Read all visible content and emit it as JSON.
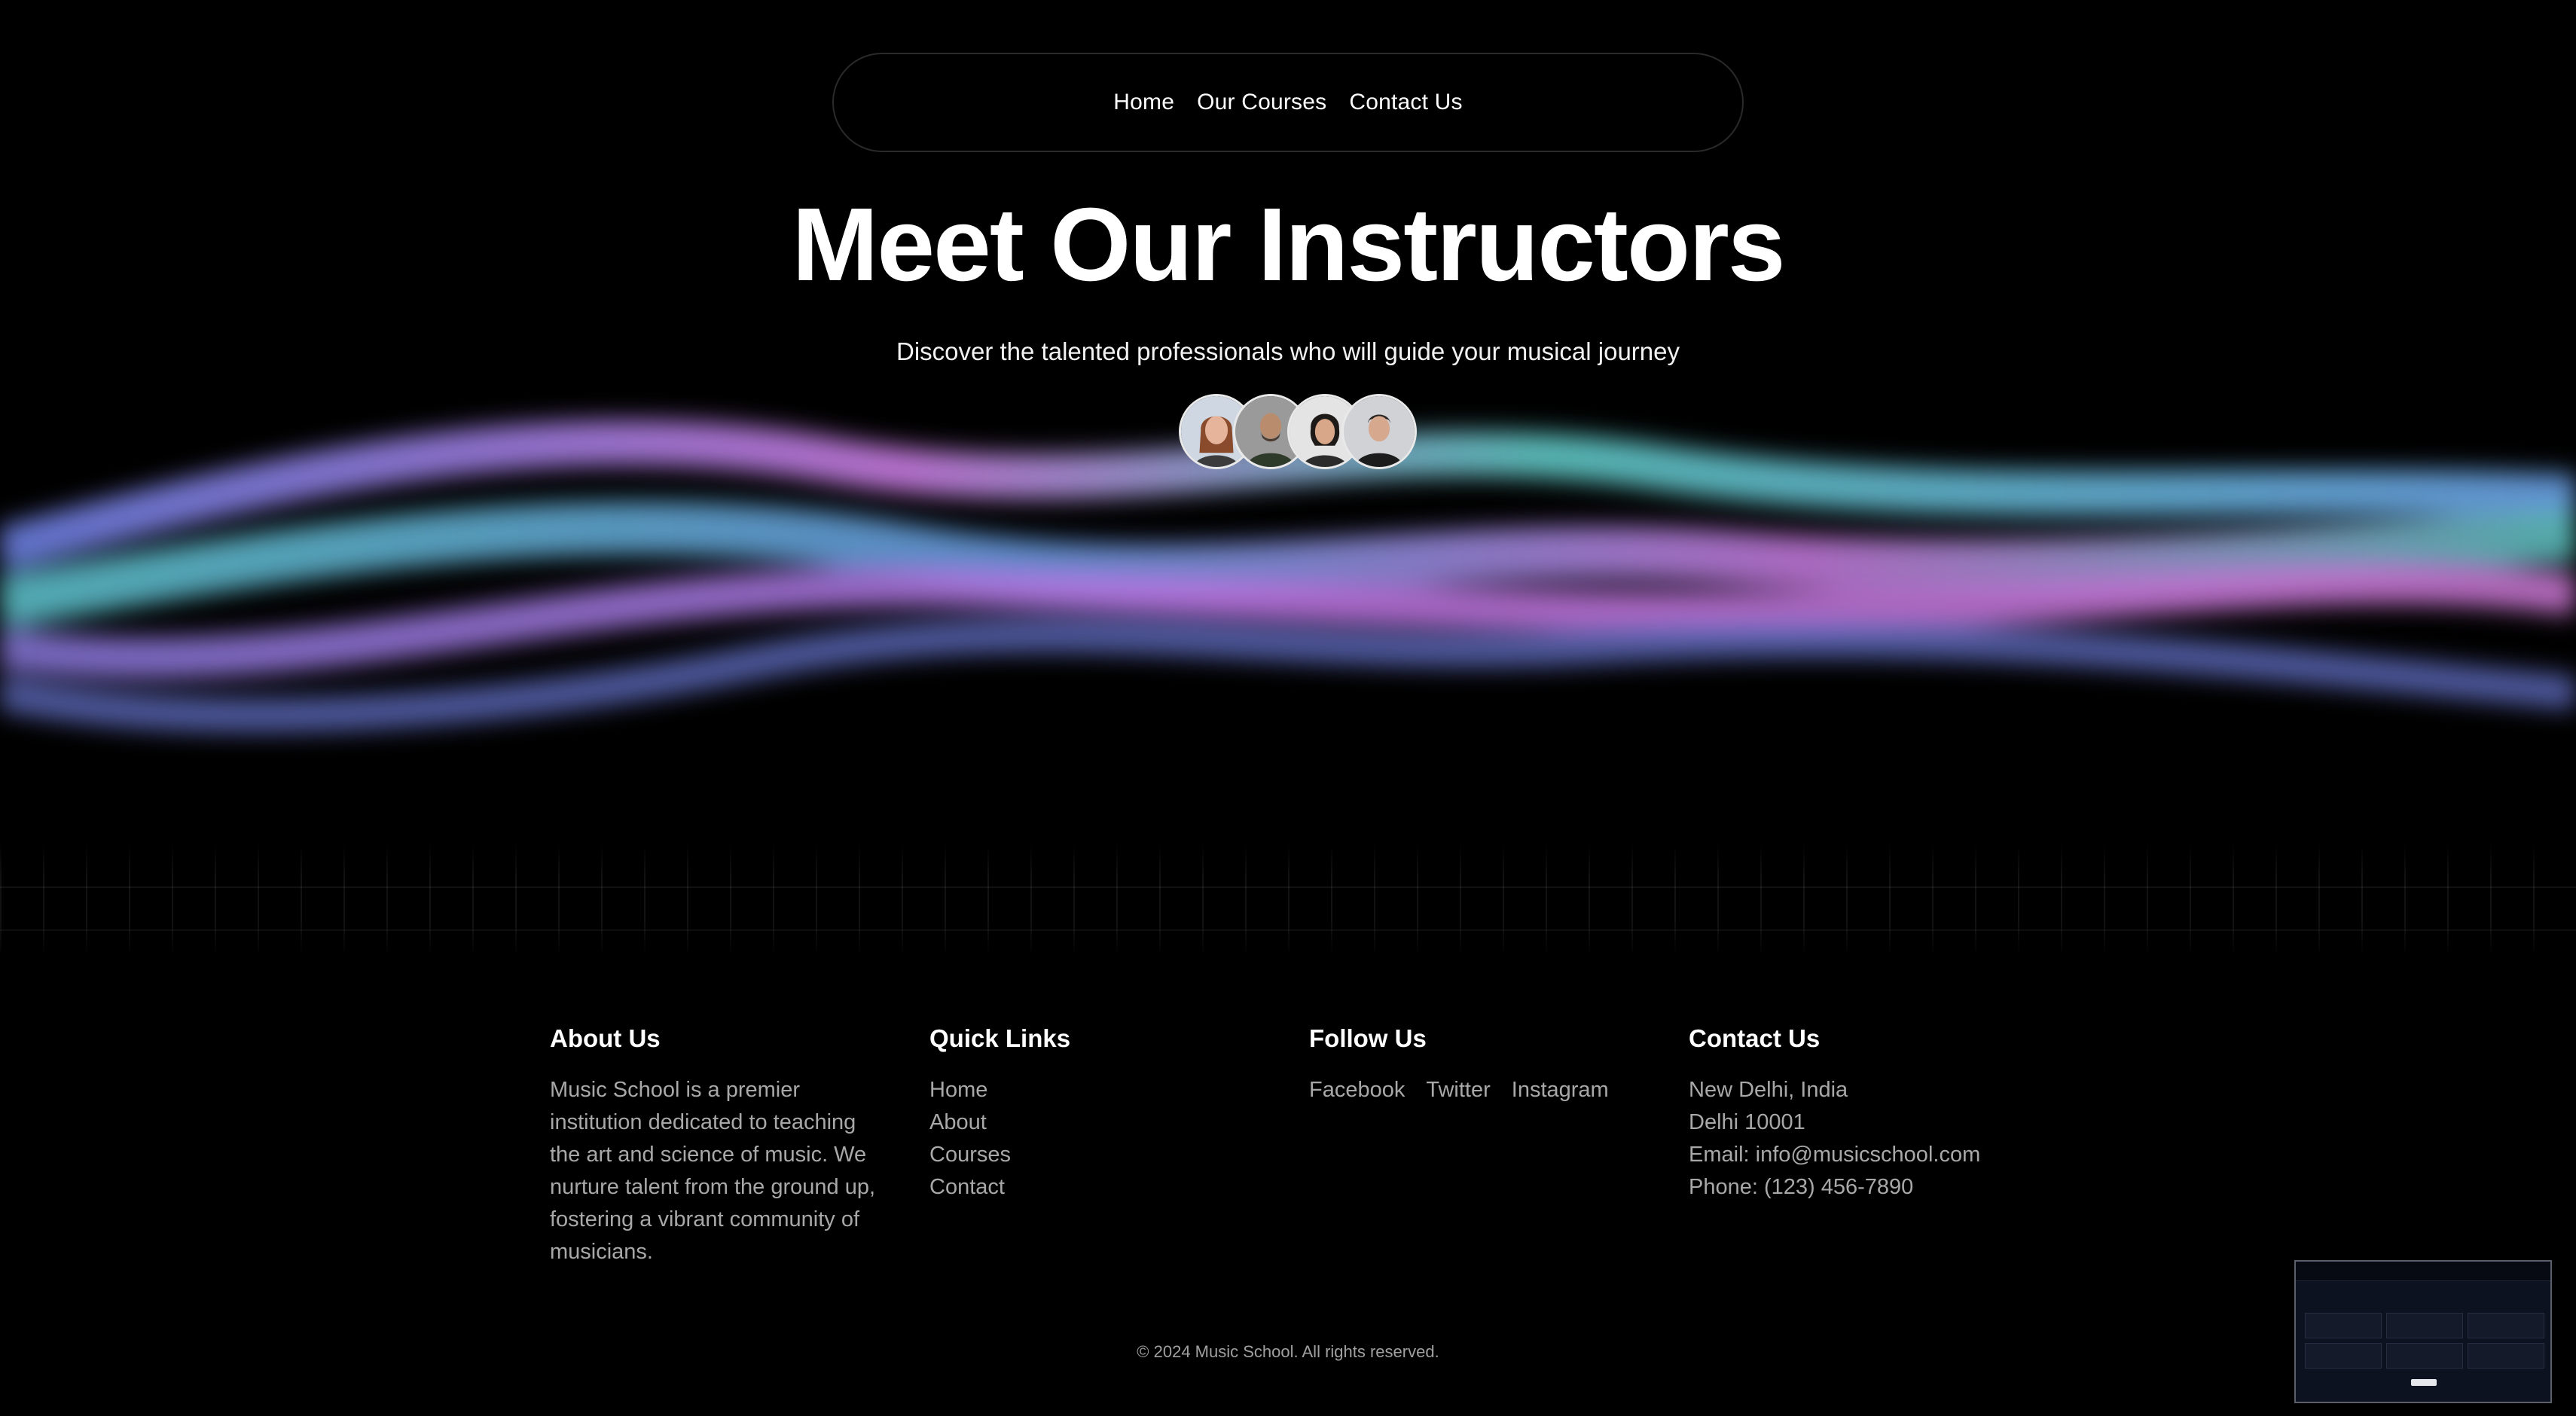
{
  "nav": {
    "items": [
      {
        "label": "Home"
      },
      {
        "label": "Our Courses"
      },
      {
        "label": "Contact Us"
      }
    ]
  },
  "hero": {
    "title": "Meet Our Instructors",
    "subtitle": "Discover the talented professionals who will guide your musical journey"
  },
  "avatars": {
    "count": 4
  },
  "footer": {
    "about": {
      "heading": "About Us",
      "text": "Music School is a premier institution dedicated to teaching the art and science of music. We nurture talent from the ground up, fostering a vibrant community of musicians."
    },
    "quick_links": {
      "heading": "Quick Links",
      "items": [
        "Home",
        "About",
        "Courses",
        "Contact"
      ]
    },
    "follow": {
      "heading": "Follow Us",
      "items": [
        "Facebook",
        "Twitter",
        "Instagram"
      ]
    },
    "contact": {
      "heading": "Contact Us",
      "lines": [
        "New Delhi, India",
        "Delhi 10001",
        "Email: info@musicschool.com",
        "Phone: (123) 456-7890"
      ]
    },
    "copyright": "© 2024 Music School. All rights reserved."
  },
  "colors": {
    "background": "#000000",
    "wave_pink": "#c77be0",
    "wave_teal": "#5fc7c4",
    "wave_blue": "#6a8de6",
    "muted_text": "#a8a8a8"
  }
}
